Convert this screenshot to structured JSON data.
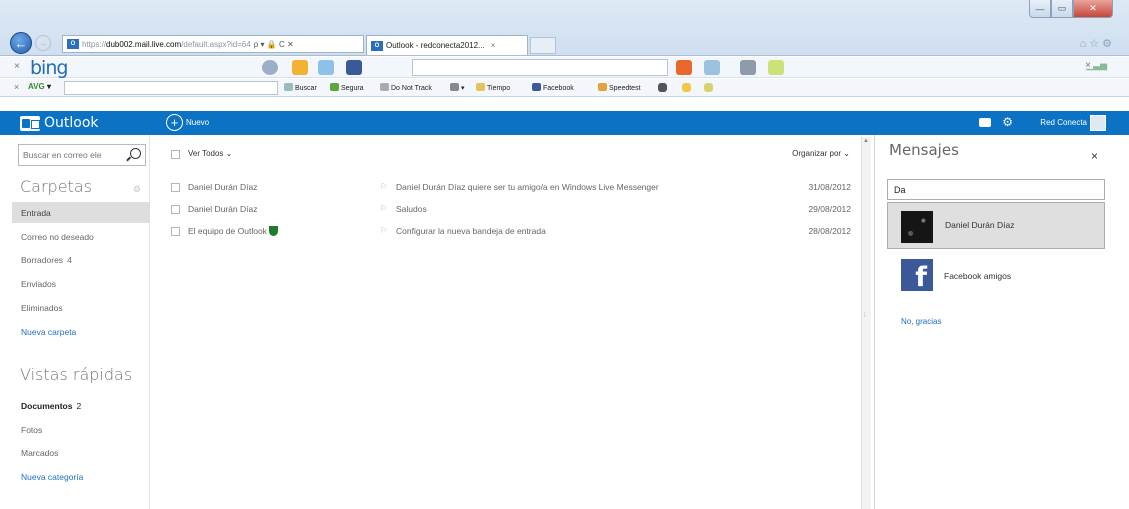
{
  "browser": {
    "address_url_gray_prefix": "https://",
    "address_url_domain": "dub002.mail.live.com",
    "address_url_rest": "/default.aspx?id=64",
    "address_icons": "ρ ▾ 🔒 C ✕",
    "tab_favicon": "O",
    "tab_title": "Outlook - redconecta2012...",
    "tab_close": "×",
    "win_min": "—",
    "win_max": "▭",
    "win_close": "✕",
    "back": "←",
    "forward": "→",
    "tools": "⌂☆⚙"
  },
  "bing_toolbar": {
    "close": "×",
    "logo": "bing",
    "signal": "▁▃▅",
    "x": "×"
  },
  "avg_toolbar": {
    "close": "×",
    "logo_prefix": "AVG",
    "logo_suffix": "▾",
    "items": [
      "Buscar",
      "Segura",
      "Do Not Track",
      "▾",
      "Tiempo",
      "Facebook",
      "Speedtest"
    ]
  },
  "outlook": {
    "app_title": "Outlook",
    "new_icon": "+",
    "new_label": "Nuevo",
    "gear": "⚙",
    "user_name": "Red Conecta"
  },
  "left_pane": {
    "search_placeholder": "Buscar en correo ele",
    "folders_title": "Carpetas",
    "folders_gear": "⚙",
    "folders": [
      {
        "label": "Entrada",
        "count": ""
      },
      {
        "label": "Correo no deseado",
        "count": ""
      },
      {
        "label": "Borradores",
        "count": "4"
      },
      {
        "label": "Enviados",
        "count": ""
      },
      {
        "label": "Eliminados",
        "count": ""
      }
    ],
    "new_folder": "Nueva carpeta",
    "quick_views_title": "Vistas rápidas",
    "quick_views": [
      {
        "label": "Documentos",
        "count": "2"
      },
      {
        "label": "Fotos",
        "count": ""
      },
      {
        "label": "Marcados",
        "count": ""
      }
    ],
    "new_category": "Nueva categoría"
  },
  "mail_list": {
    "view_all": "Ver Todos ⌄",
    "sort_by": "Organizar por ⌄",
    "flag": "⚐",
    "rows": [
      {
        "sender": "Daniel Durán Díaz",
        "subject": "Daniel Durán Díaz quiere ser tu amigo/a en Windows Live Messenger",
        "date": "31/08/2012"
      },
      {
        "sender": "Daniel Durán Díaz",
        "subject": "Saludos",
        "date": "29/08/2012"
      },
      {
        "sender": "El equipo de Outlook",
        "subject": "Configurar la nueva bandeja de entrada",
        "date": "28/08/2012"
      }
    ]
  },
  "scrollbar": {
    "up": "▲",
    "grip": "⁞"
  },
  "messaging": {
    "title": "Mensajes",
    "close": "×",
    "input_value": "Da",
    "suggestion_name": "Daniel Durán Díaz",
    "facebook_logo": "f",
    "facebook_name": "Facebook amigos",
    "no_thanks": "No, gracias"
  }
}
